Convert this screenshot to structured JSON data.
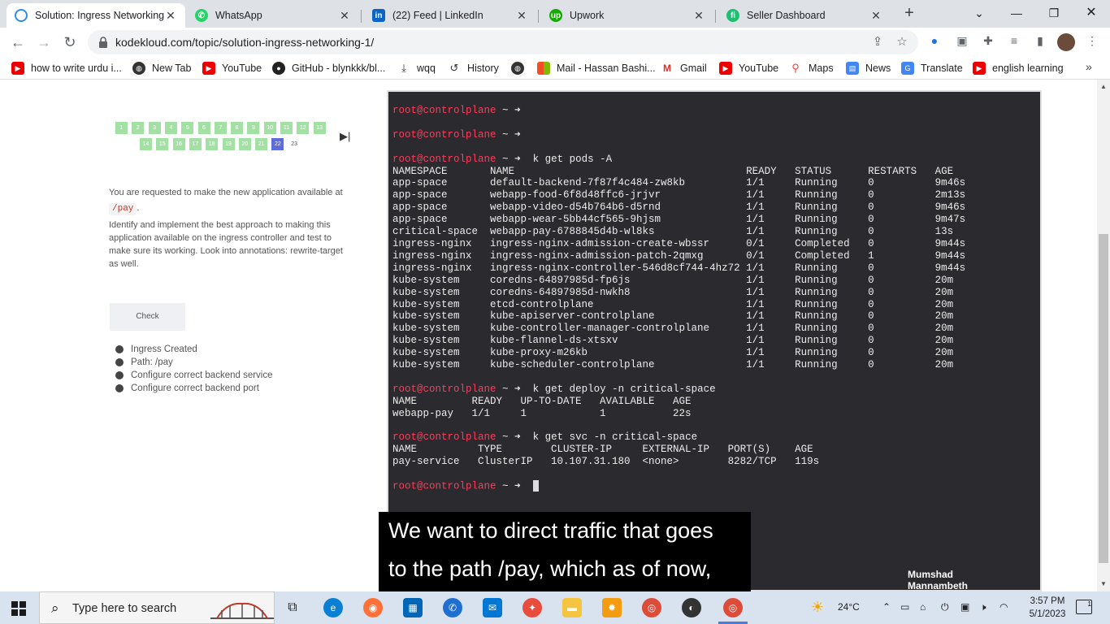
{
  "tabs": [
    {
      "label": "Solution: Ingress Networking",
      "icon": "kodekloud-icon",
      "active": true
    },
    {
      "label": "WhatsApp",
      "icon": "whatsapp-icon",
      "active": false
    },
    {
      "label": "(22) Feed | LinkedIn",
      "icon": "linkedin-icon",
      "active": false
    },
    {
      "label": "Upwork",
      "icon": "upwork-icon",
      "active": false
    },
    {
      "label": "Seller Dashboard",
      "icon": "fiverr-icon",
      "active": false
    }
  ],
  "address": {
    "url": "kodekloud.com/topic/solution-ingress-networking-1/"
  },
  "bookmarks": [
    {
      "label": "how to write urdu i...",
      "icon": "youtube-icon"
    },
    {
      "label": "New Tab",
      "icon": "globe-icon"
    },
    {
      "label": "YouTube",
      "icon": "youtube-icon"
    },
    {
      "label": "GitHub - blynkkk/bl...",
      "icon": "github-icon"
    },
    {
      "label": "wqq",
      "icon": "download-icon"
    },
    {
      "label": "History",
      "icon": "history-icon"
    },
    {
      "label": "",
      "icon": "globe-icon"
    },
    {
      "label": "Mail - Hassan Bashi...",
      "icon": "microsoft-icon"
    },
    {
      "label": "Gmail",
      "icon": "gmail-icon"
    },
    {
      "label": "YouTube",
      "icon": "youtube-icon"
    },
    {
      "label": "Maps",
      "icon": "maps-icon"
    },
    {
      "label": "News",
      "icon": "news-icon"
    },
    {
      "label": "Translate",
      "icon": "translate-icon"
    },
    {
      "label": "english learning",
      "icon": "youtube-icon"
    }
  ],
  "lesson": {
    "questions_row1": [
      "1",
      "2",
      "3",
      "4",
      "5",
      "6",
      "7",
      "8",
      "9",
      "10",
      "11",
      "12",
      "13"
    ],
    "questions_row2": [
      "14",
      "15",
      "16",
      "17",
      "18",
      "19",
      "20",
      "21",
      "22",
      "23"
    ],
    "current_question": "22",
    "skip_icon": "skip-next-icon",
    "instruction_part1": "You are requested to make the new application available at",
    "instruction_code": "/pay",
    "instruction_part2": "Identify and implement the best approach to making this application available on the ingress controller and test to make sure its working. Look into annotations: rewrite-target as well.",
    "check_label": "Check",
    "tasks": [
      "Ingress Created",
      "Path: /pay",
      "Configure correct backend service",
      "Configure correct backend port"
    ]
  },
  "terminal": {
    "prompt_user": "root@controlplane",
    "prompt_suffix": " ~ ➜",
    "lines": [
      {
        "type": "prompt",
        "cmd": ""
      },
      {
        "type": "blank"
      },
      {
        "type": "prompt",
        "cmd": ""
      },
      {
        "type": "blank"
      },
      {
        "type": "prompt",
        "cmd": "k get pods -A"
      },
      {
        "type": "out",
        "text": "NAMESPACE       NAME                                      READY   STATUS      RESTARTS   AGE"
      },
      {
        "type": "out",
        "text": "app-space       default-backend-7f87f4c484-zw8kb          1/1     Running     0          9m46s"
      },
      {
        "type": "out",
        "text": "app-space       webapp-food-6f8d48ffc6-jrjvr              1/1     Running     0          2m13s"
      },
      {
        "type": "out",
        "text": "app-space       webapp-video-d54b764b6-d5rnd              1/1     Running     0          9m46s"
      },
      {
        "type": "out",
        "text": "app-space       webapp-wear-5bb44cf565-9hjsm              1/1     Running     0          9m47s"
      },
      {
        "type": "out",
        "text": "critical-space  webapp-pay-6788845d4b-wl8ks               1/1     Running     0          13s"
      },
      {
        "type": "out",
        "text": "ingress-nginx   ingress-nginx-admission-create-wbssr      0/1     Completed   0          9m44s"
      },
      {
        "type": "out",
        "text": "ingress-nginx   ingress-nginx-admission-patch-2qmxg       0/1     Completed   1          9m44s"
      },
      {
        "type": "out",
        "text": "ingress-nginx   ingress-nginx-controller-546d8cf744-4hz72 1/1     Running     0          9m44s"
      },
      {
        "type": "out",
        "text": "kube-system     coredns-64897985d-fp6js                   1/1     Running     0          20m"
      },
      {
        "type": "out",
        "text": "kube-system     coredns-64897985d-nwkh8                   1/1     Running     0          20m"
      },
      {
        "type": "out",
        "text": "kube-system     etcd-controlplane                         1/1     Running     0          20m"
      },
      {
        "type": "out",
        "text": "kube-system     kube-apiserver-controlplane               1/1     Running     0          20m"
      },
      {
        "type": "out",
        "text": "kube-system     kube-controller-manager-controlplane      1/1     Running     0          20m"
      },
      {
        "type": "out",
        "text": "kube-system     kube-flannel-ds-xtsxv                     1/1     Running     0          20m"
      },
      {
        "type": "out",
        "text": "kube-system     kube-proxy-m26kb                          1/1     Running     0          20m"
      },
      {
        "type": "out",
        "text": "kube-system     kube-scheduler-controlplane               1/1     Running     0          20m"
      },
      {
        "type": "blank"
      },
      {
        "type": "prompt",
        "cmd": "k get deploy -n critical-space"
      },
      {
        "type": "out",
        "text": "NAME         READY   UP-TO-DATE   AVAILABLE   AGE"
      },
      {
        "type": "out",
        "text": "webapp-pay   1/1     1            1           22s"
      },
      {
        "type": "blank"
      },
      {
        "type": "prompt",
        "cmd": "k get svc -n critical-space"
      },
      {
        "type": "out",
        "text": "NAME          TYPE        CLUSTER-IP     EXTERNAL-IP   PORT(S)    AGE"
      },
      {
        "type": "out",
        "text": "pay-service   ClusterIP   10.107.31.180  <none>        8282/TCP   119s"
      },
      {
        "type": "blank"
      },
      {
        "type": "prompt",
        "cmd": "",
        "cursor": true
      }
    ]
  },
  "caption": {
    "line1": "We want to direct traffic that goes",
    "line2": "to the path /pay, which as of now,"
  },
  "watermark": {
    "line1": "Mumshad",
    "line2": "Mannambeth"
  },
  "taskbar": {
    "search_placeholder": "Type here to search",
    "weather": "24°C",
    "time": "3:57 PM",
    "date": "5/1/2023",
    "notification_count": "1"
  },
  "colors": {
    "accent": "#5f6bd8",
    "done": "#a3e0a3",
    "prompt": "#ff3b5a",
    "terminal_bg": "#2b2b2f"
  }
}
